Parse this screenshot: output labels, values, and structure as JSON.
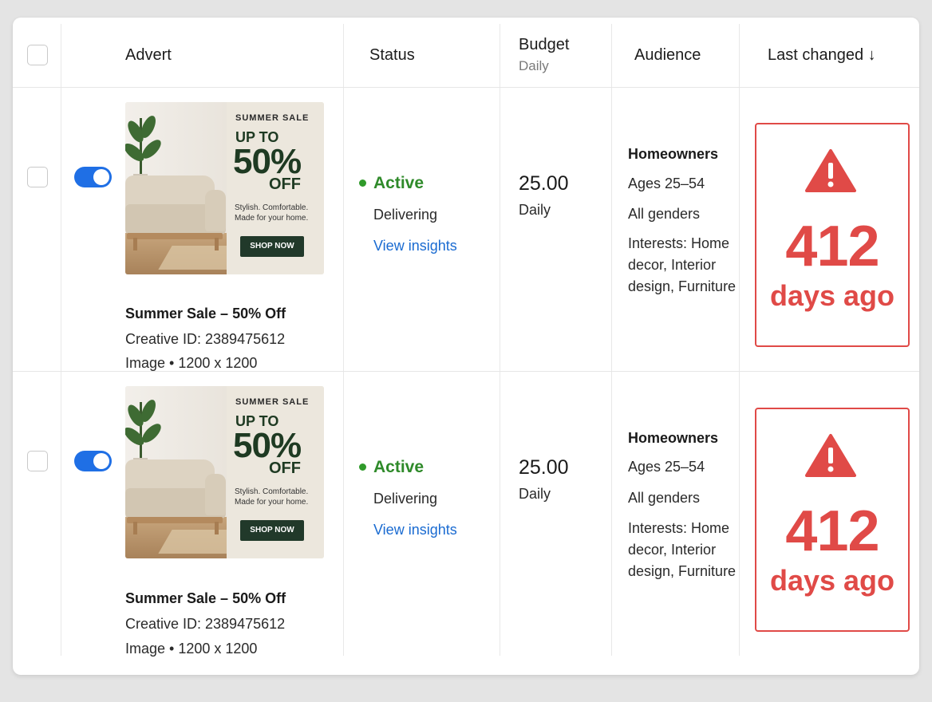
{
  "table": {
    "headers": {
      "advert": "Advert",
      "status": "Status",
      "budget": "Budget",
      "budget_sub": "Daily",
      "audience": "Audience",
      "last_changed": "Last changed ↓"
    },
    "rows": [
      {
        "ad": {
          "kicker": "SUMMER SALE",
          "upto": "UP TO",
          "pct": "50%",
          "off": "OFF",
          "copy": "Stylish. Comfortable. Made for your home.",
          "cta": "SHOP NOW",
          "name": "Summer Sale – 50% Off",
          "creative_id": "Creative ID: 2389475612",
          "format": "Image • 1200 x 1200"
        },
        "status": "Active",
        "delivery": "Delivering",
        "insights": "View insights",
        "budget": "25.00",
        "budget_period": "Daily",
        "audience": {
          "title": "Homeowners",
          "ages": "Ages 25–54",
          "genders": "All genders",
          "interests": "Interests: Home decor, Interior design, Furniture"
        },
        "last_changed": {
          "value": "412",
          "unit": "days ago"
        }
      },
      {
        "ad": {
          "kicker": "SUMMER SALE",
          "upto": "UP TO",
          "pct": "50%",
          "off": "OFF",
          "copy": "Stylish. Comfortable. Made for your home.",
          "cta": "SHOP NOW",
          "name": "Summer Sale – 50% Off",
          "creative_id": "Creative ID: 2389475612",
          "format": "Image • 1200 x 1200"
        },
        "status": "Active",
        "delivery": "Delivering",
        "insights": "View insights",
        "budget": "25.00",
        "budget_period": "Daily",
        "audience": {
          "title": "Homeowners",
          "ages": "Ages 25–54",
          "genders": "All genders",
          "interests": "Interests: Home decor, Interior design, Furniture"
        },
        "last_changed": {
          "value": "412",
          "unit": "days ago"
        }
      }
    ]
  },
  "colors": {
    "accent": "#1f6fe5",
    "active_green": "#2f8a2a",
    "warning_red": "#e04a47",
    "link_blue": "#1a6bd1"
  },
  "icons": {
    "warning": "warning-triangle-icon",
    "sort": "arrow-down-icon"
  }
}
